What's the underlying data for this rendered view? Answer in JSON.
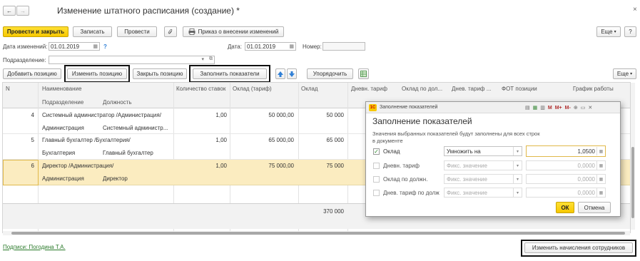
{
  "window": {
    "title": "Изменение штатного расписания (создание) *",
    "close_glyph": "×"
  },
  "nav": {
    "back_glyph": "←",
    "forward_glyph": "→"
  },
  "toolbar": {
    "post_close": "Провести и закрыть",
    "save": "Записать",
    "post": "Провести",
    "print_order": "Приказ о внесении изменений",
    "more": "Еще",
    "help": "?"
  },
  "form": {
    "change_date_label": "Дата изменений:",
    "change_date_value": "01.01.2019",
    "help_mark": "?",
    "date_label": "Дата:",
    "date_value": "01.01.2019",
    "number_label": "Номер:",
    "number_value": "",
    "division_label": "Подразделение:",
    "division_value": ""
  },
  "table_toolbar": {
    "add": "Добавить позицию",
    "change": "Изменить позицию",
    "close": "Закрыть позицию",
    "fill": "Заполнить показатели",
    "sort": "Упорядочить",
    "more": "Еще"
  },
  "table": {
    "headers": {
      "n": "N",
      "name": "Наименование",
      "division": "Подразделение",
      "position": "Должность",
      "rates": "Количество ставок",
      "salary_tariff": "Оклад (тариф)",
      "salary": "Оклад",
      "daily_tariff": "Дневн. тариф",
      "salary_by": "Оклад по дол...",
      "daily_tariff_by": "Днев. тариф ...",
      "fot": "ФОТ позиции",
      "schedule": "График работы"
    },
    "rows": [
      {
        "n": "4",
        "name": "Системный администратор /Администрация/",
        "division": "Администрация",
        "position": "Системный администр...",
        "rates": "1,00",
        "salary_tariff": "50 000,00",
        "salary": "50 000"
      },
      {
        "n": "5",
        "name": "Главный бухгалтер /Бухгалтерия/",
        "division": "Бухгалтерия",
        "position": "Главный бухгалтер",
        "rates": "1,00",
        "salary_tariff": "65 000,00",
        "salary": "65 000"
      },
      {
        "n": "6",
        "name": "Директор /Администрация/",
        "division": "Администрация",
        "position": "Директор",
        "rates": "1,00",
        "salary_tariff": "75 000,00",
        "salary": "75 000"
      }
    ],
    "total_salary": "370 000"
  },
  "footer": {
    "signatures": "Подписи: Погодина Т.А.",
    "change_accruals": "Изменить начисления сотрудников"
  },
  "dialog": {
    "window_title": "Заполнение показателей",
    "header_icons": [
      "M",
      "M+",
      "M-"
    ],
    "heading": "Заполнение показателей",
    "description": "Значения выбранных показателей будут заполнены для всех строк в документе",
    "rows": [
      {
        "label": "Оклад",
        "checked": true,
        "method": "Умножить на",
        "value": "1,0500"
      },
      {
        "label": "Дневн. тариф",
        "checked": false,
        "method": "Фикс. значение",
        "value": "0,0000"
      },
      {
        "label": "Оклад по должн.",
        "checked": false,
        "method": "Фикс. значение",
        "value": "0,0000"
      },
      {
        "label": "Днев. тариф по долж",
        "checked": false,
        "method": "Фикс. значение",
        "value": "0,0000"
      }
    ],
    "ok": "ОК",
    "cancel": "Отмена",
    "check_glyph": "✓"
  },
  "colors": {
    "primary_button": "#f7c800",
    "selected_row": "#fbecc0",
    "link_green": "#2a7a2a",
    "arrow_blue": "#2f7fd6",
    "highlight_frame": "#111111"
  }
}
